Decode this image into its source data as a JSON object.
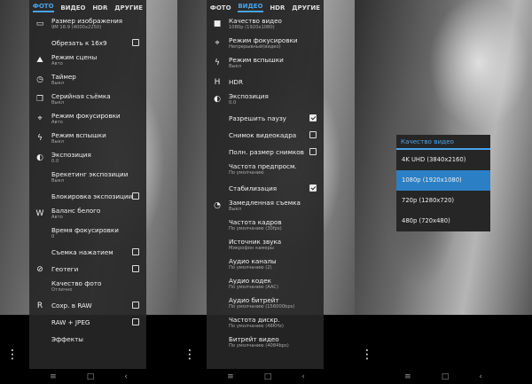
{
  "photo_panel": {
    "tabs": [
      "ФОТО",
      "ВИДЕО",
      "HDR",
      "ДРУГИЕ"
    ],
    "active_tab": 0,
    "items": [
      {
        "title": "Размер изображения",
        "sub": "9M 16:9 (4000x2250)",
        "icon": "image-size-icon",
        "glyph": "▭"
      },
      {
        "title": "Обрезать к 16x9",
        "sub": "",
        "checkbox": false
      },
      {
        "title": "Режим сцены",
        "sub": "Авто",
        "icon": "scene-mode-icon",
        "glyph": "⛰"
      },
      {
        "title": "Таймер",
        "sub": "Выкл",
        "icon": "timer-icon",
        "glyph": "◷"
      },
      {
        "title": "Серийная съёмка",
        "sub": "Выкл",
        "icon": "burst-icon",
        "glyph": "❐"
      },
      {
        "title": "Режим фокусировки",
        "sub": "Авто",
        "icon": "focus-icon",
        "glyph": "⌖"
      },
      {
        "title": "Режим вспышки",
        "sub": "Выкл",
        "icon": "flash-off-icon",
        "glyph": "ϟ"
      },
      {
        "title": "Экспозиция",
        "sub": "0.0",
        "icon": "exposure-icon",
        "glyph": "◐"
      },
      {
        "title": "Брекетинг экспозиции",
        "sub": "Выкл"
      },
      {
        "title": "Блокировка экспозиции",
        "sub": "",
        "checkbox": false
      },
      {
        "title": "Баланс белого",
        "sub": "Авто",
        "icon": "white-balance-icon",
        "glyph": "W"
      },
      {
        "title": "Время фокусировки",
        "sub": "0"
      },
      {
        "title": "Съемка нажатием",
        "sub": "",
        "checkbox": false
      },
      {
        "title": "Геотеги",
        "sub": "",
        "checkbox": false,
        "icon": "geotag-off-icon",
        "glyph": "⊘"
      },
      {
        "title": "Качество фото",
        "sub": "Отлично"
      },
      {
        "title": "Сохр. в RAW",
        "sub": "",
        "checkbox": false,
        "icon": "raw-icon",
        "glyph": "R"
      },
      {
        "title": "RAW + JPEG",
        "sub": "",
        "checkbox": false
      },
      {
        "title": "Эффекты",
        "sub": ""
      }
    ]
  },
  "video_panel": {
    "tabs": [
      "ФОТО",
      "ВИДЕО",
      "HDR",
      "ДРУГИЕ"
    ],
    "active_tab": 1,
    "items": [
      {
        "title": "Качество видео",
        "sub": "1080p (1920x1080)",
        "icon": "video-camera-icon",
        "glyph": "■"
      },
      {
        "title": "Режим фокусировки",
        "sub": "Непрерывный(видео)",
        "icon": "focus-icon",
        "glyph": "⌖"
      },
      {
        "title": "Режим вспышки",
        "sub": "Выкл",
        "icon": "flash-off-icon",
        "glyph": "ϟ"
      },
      {
        "title": "HDR",
        "sub": "",
        "icon": "hdr-icon",
        "glyph": "H"
      },
      {
        "title": "Экспозиция",
        "sub": "0.0",
        "icon": "exposure-icon",
        "glyph": "◐"
      },
      {
        "title": "Разрешить паузу",
        "sub": "",
        "checkbox": true
      },
      {
        "title": "Снимок видеокадра",
        "sub": "",
        "checkbox": false
      },
      {
        "title": "Полн. размер снимков",
        "sub": "",
        "checkbox": false
      },
      {
        "title": "Частота предпросм.",
        "sub": "По умолчанию"
      },
      {
        "title": "Стабилизация",
        "sub": "",
        "checkbox": true
      },
      {
        "title": "Замедленная съемка",
        "sub": "Выкл",
        "icon": "slow-motion-icon",
        "glyph": "◔"
      },
      {
        "title": "Частота кадров",
        "sub": "По умолчанию (30fps)"
      },
      {
        "title": "Источник звука",
        "sub": "Микрофон камеры"
      },
      {
        "title": "Аудио каналы",
        "sub": "По умолчанию (2)"
      },
      {
        "title": "Аудио кодек",
        "sub": "По умолчанию (AAC)"
      },
      {
        "title": "Аудио битрейт",
        "sub": "По умолчанию (156000bps)"
      },
      {
        "title": "Частота дискр.",
        "sub": "По умолчанию (48KHz)"
      },
      {
        "title": "Битрейт видео",
        "sub": "По умолчанию (4084bps)"
      }
    ]
  },
  "quality_dialog": {
    "title": "Качество видео",
    "options": [
      "4K UHD (3840x2160)",
      "1080p (1920x1080)",
      "720p (1280x720)",
      "480p (720x480)"
    ],
    "selected": 1
  },
  "nav": {
    "menu": "≡",
    "home": "□",
    "back": "‹",
    "more": "⋮"
  },
  "colors": {
    "accent": "#4aa3e8",
    "selected": "#2b7fc4"
  }
}
